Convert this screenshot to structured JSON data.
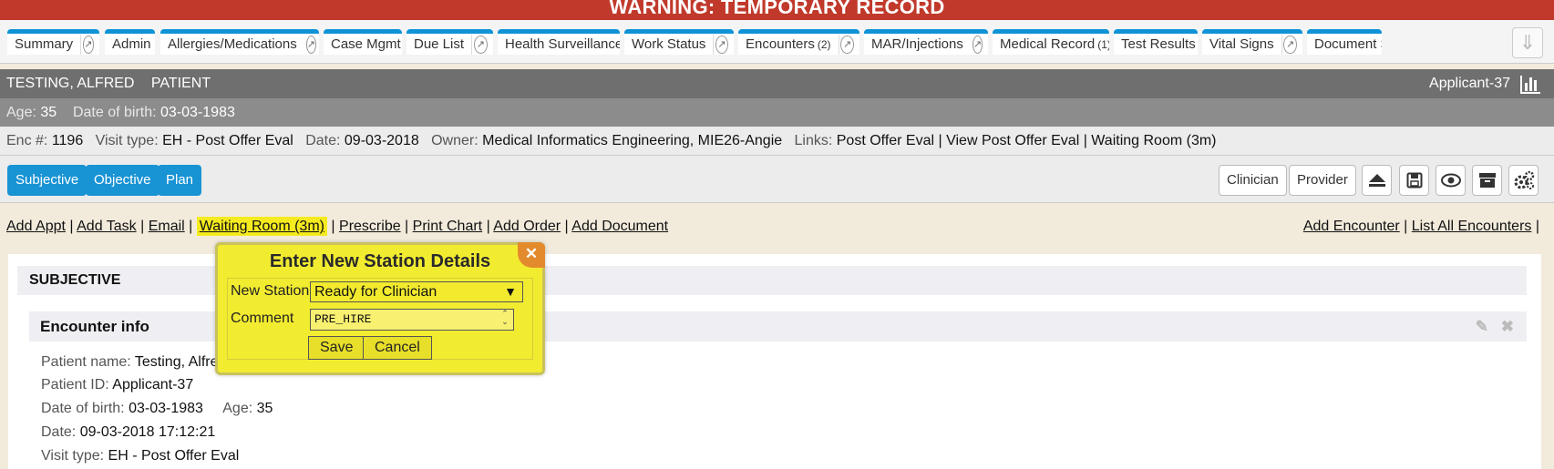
{
  "warning": "WARNING: TEMPORARY RECORD",
  "tabs": [
    {
      "label": "Summary",
      "icon": "external-link-icon"
    },
    {
      "label": "Admin",
      "corner": true
    },
    {
      "label": "Allergies/Medications",
      "icon": "external-link-icon"
    },
    {
      "label": "Case Mgmt",
      "corner": true
    },
    {
      "label": "Due List",
      "icon": "external-link-icon"
    },
    {
      "label": "Health Surveillance",
      "corner": true
    },
    {
      "label": "Work Status",
      "icon": "external-link-icon"
    },
    {
      "label": "Encounters",
      "count": "(2)",
      "icon": "external-link-icon"
    },
    {
      "label": "MAR/Injections",
      "icon": "external-link-icon"
    },
    {
      "label": "Medical Record",
      "count": "(1)",
      "corner": true
    },
    {
      "label": "Test Results",
      "corner": true
    },
    {
      "label": "Vital Signs",
      "icon": "external-link-icon"
    },
    {
      "label": "Document S"
    }
  ],
  "patient": {
    "name": "TESTING, ALFRED",
    "role": "PATIENT",
    "id": "Applicant-37",
    "age_label": "Age:",
    "age": "35",
    "dob_label": "Date of birth:",
    "dob": "03-03-1983"
  },
  "encounter": {
    "enc_label": "Enc #:",
    "enc": "1196",
    "visit_label": "Visit type:",
    "visit": "EH - Post Offer Eval",
    "date_label": "Date:",
    "date": "09-03-2018",
    "owner_label": "Owner:",
    "owner": "Medical Informatics Engineering, MIE26-Angie",
    "links_label": "Links:",
    "links": "Post Offer Eval | View Post Offer Eval | Waiting Room (3m)"
  },
  "soap_buttons": [
    "Subjective",
    "Objective",
    "Plan"
  ],
  "tool_buttons": [
    "Clinician",
    "Provider"
  ],
  "icon_buttons": [
    "eject-icon",
    "save-icon",
    "eye-icon",
    "archive-icon",
    "gears-icon"
  ],
  "links_left": [
    "Add Appt",
    "Add Task",
    "Email",
    "Waiting Room (3m)",
    "Prescribe",
    "Print Chart",
    "Add Order",
    "Add Document"
  ],
  "links_right": [
    "Add Encounter",
    "List All Encounters"
  ],
  "section": {
    "title": "SUBJECTIVE",
    "sub_title": "Encounter info",
    "info": [
      {
        "label": "Patient name:",
        "value": "Testing, Alfre"
      },
      {
        "label": "Patient ID:",
        "value": "Applicant-37"
      },
      {
        "label": "Date of birth:",
        "value": "03-03-1983",
        "label2": "Age:",
        "value2": "35"
      },
      {
        "label": "Date:",
        "value": "09-03-2018 17:12:21"
      },
      {
        "label": "Visit type:",
        "value": "EH - Post Offer Eval"
      }
    ]
  },
  "modal": {
    "title": "Enter New Station Details",
    "station_label": "New Station",
    "station_value": "Ready for Clinician",
    "comment_label": "Comment",
    "comment_value": "PRE_HIRE",
    "save_label": "Save",
    "cancel_label": "Cancel"
  },
  "colors": {
    "warning": "#c0392b",
    "accent": "#1893d4",
    "highlight": "#f5ea1f"
  }
}
